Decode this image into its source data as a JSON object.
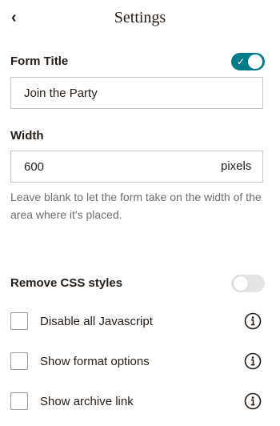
{
  "header": {
    "title": "Settings",
    "back_icon": "‹"
  },
  "form_title": {
    "label": "Form Title",
    "toggle_on": true,
    "value": "Join the Party"
  },
  "width": {
    "label": "Width",
    "value": "600",
    "unit": "pixels",
    "helper": "Leave blank to let the form take on the width of the area where it's placed."
  },
  "remove_css": {
    "label": "Remove CSS styles",
    "toggle_on": false
  },
  "options": [
    {
      "label": "Disable all Javascript",
      "checked": false,
      "info_icon": "info-icon"
    },
    {
      "label": "Show format options",
      "checked": false,
      "info_icon": "info-icon"
    },
    {
      "label": "Show archive link",
      "checked": false,
      "info_icon": "info-icon"
    }
  ],
  "colors": {
    "accent": "#007c89",
    "text": "#241c15",
    "muted": "#6e6e6e",
    "border": "#c5c5c5"
  }
}
